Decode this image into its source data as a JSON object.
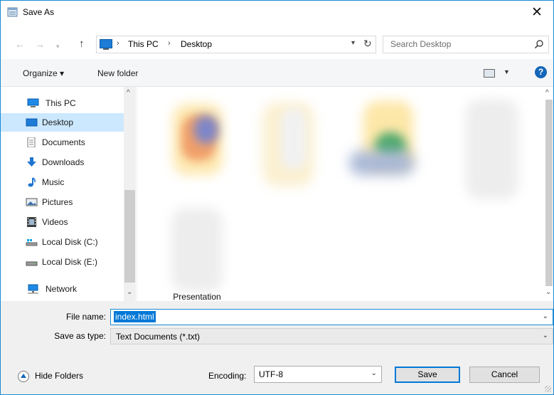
{
  "window": {
    "title": "Save As"
  },
  "nav": {
    "breadcrumbs": [
      "This PC",
      "Desktop"
    ],
    "search_placeholder": "Search Desktop"
  },
  "toolbar": {
    "organize": "Organize ▾",
    "new_folder": "New folder"
  },
  "sidebar": {
    "items": [
      {
        "label": "This PC",
        "icon": "computer-icon"
      },
      {
        "label": "Desktop",
        "icon": "desktop-icon",
        "selected": true
      },
      {
        "label": "Documents",
        "icon": "documents-icon"
      },
      {
        "label": "Downloads",
        "icon": "downloads-icon"
      },
      {
        "label": "Music",
        "icon": "music-icon"
      },
      {
        "label": "Pictures",
        "icon": "pictures-icon"
      },
      {
        "label": "Videos",
        "icon": "videos-icon"
      },
      {
        "label": "Local Disk (C:)",
        "icon": "local-disk-c-icon"
      },
      {
        "label": "Local Disk (E:)",
        "icon": "local-disk-e-icon"
      },
      {
        "label": "Network",
        "icon": "network-icon"
      }
    ]
  },
  "files": {
    "caption_partial": "Presentation"
  },
  "form": {
    "file_name_label": "File name:",
    "file_name_value": "index.html",
    "save_type_label": "Save as type:",
    "save_type_value": "Text Documents (*.txt)",
    "encoding_label": "Encoding:",
    "encoding_value": "UTF-8"
  },
  "footer": {
    "hide_folders": "Hide Folders",
    "save_button": "Save",
    "cancel_button": "Cancel"
  },
  "colors": {
    "accent": "#0078d7",
    "selection": "#cce8ff",
    "border": "#1a8ad4"
  }
}
